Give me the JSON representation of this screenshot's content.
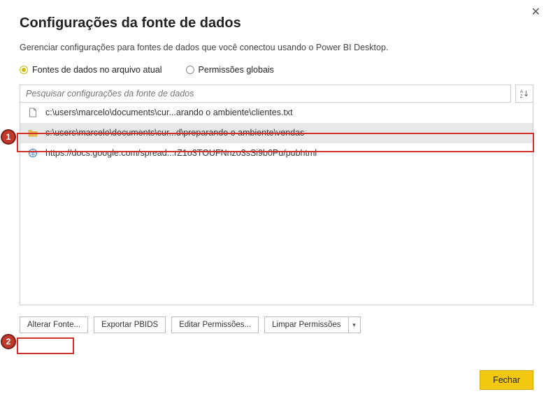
{
  "header": {
    "title": "Configurações da fonte de dados",
    "subtitle": "Gerenciar configurações para fontes de dados que você conectou usando o Power BI Desktop."
  },
  "radios": {
    "current_file": "Fontes de dados no arquivo atual",
    "global": "Permissões globais",
    "selected": "current_file"
  },
  "search": {
    "placeholder": "Pesquisar configurações da fonte de dados"
  },
  "sources": [
    {
      "icon": "file",
      "label": "c:\\users\\marcelo\\documents\\cur...arando o ambiente\\clientes.txt",
      "selected": false
    },
    {
      "icon": "folder",
      "label": "c:\\users\\marcelo\\documents\\cur...d\\preparando o ambiente\\vendas",
      "selected": true
    },
    {
      "icon": "web",
      "label": "https://docs.google.com/spread...rZ1o3TOUFNnzo3sSi9b0Pu/pubhtml",
      "selected": false
    }
  ],
  "buttons": {
    "change_source": "Alterar Fonte...",
    "export_pbids": "Exportar PBIDS",
    "edit_permissions": "Editar Permissões...",
    "clear_permissions": "Limpar Permissões",
    "close": "Fechar"
  },
  "callouts": {
    "one": "1",
    "two": "2"
  }
}
